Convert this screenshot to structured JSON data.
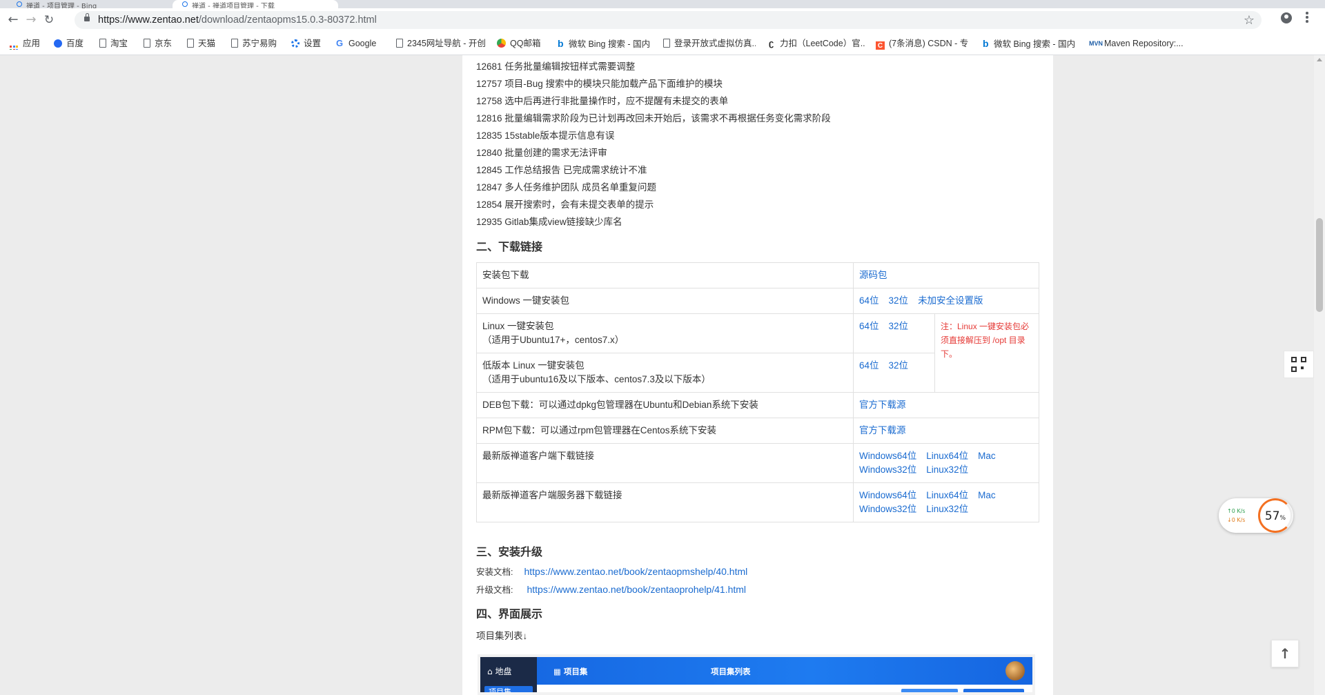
{
  "browser": {
    "tabs": [
      {
        "title": "禅道 - 项目管理 - Bing"
      },
      {
        "title": "禅道 - 禅道项目管理 - 下载"
      }
    ],
    "url_host": "https://www.zentao.net",
    "url_path": "/download/zentaopms15.0.3-80372.html",
    "bookmarks": [
      {
        "label": "应用",
        "icon": "apps-icon"
      },
      {
        "label": "百度",
        "icon": "baidu-paw-icon"
      },
      {
        "label": "淘宝",
        "icon": "page-icon"
      },
      {
        "label": "京东",
        "icon": "page-icon"
      },
      {
        "label": "天猫",
        "icon": "page-icon"
      },
      {
        "label": "苏宁易购",
        "icon": "page-icon"
      },
      {
        "label": "设置",
        "icon": "gear-icon"
      },
      {
        "label": "Google",
        "icon": "google-icon"
      },
      {
        "label": "2345网址导航 - 开创...",
        "icon": "page-icon"
      },
      {
        "label": "QQ邮箱",
        "icon": "qq-mail-icon"
      },
      {
        "label": "微软 Bing 搜索 - 国内...",
        "icon": "bing-icon"
      },
      {
        "label": "登录开放式虚拟仿真...",
        "icon": "page-icon"
      },
      {
        "label": "力扣（LeetCode）官...",
        "icon": "leetcode-icon"
      },
      {
        "label": "(7条消息) CSDN - 专...",
        "icon": "csdn-icon"
      },
      {
        "label": "微软 Bing 搜索 - 国内...",
        "icon": "bing-icon"
      },
      {
        "label": "Maven Repository:...",
        "icon": "maven-icon"
      }
    ]
  },
  "changelog": [
    "12681 任务批量编辑按钮样式需要调整",
    "12757 项目-Bug 搜索中的模块只能加载产品下面维护的模块",
    "12758 选中后再进行非批量操作时，应不提醒有未提交的表单",
    "12816 批量编辑需求阶段为已计划再改回未开始后，该需求不再根据任务变化需求阶段",
    "12835 15stable版本提示信息有误",
    "12840 批量创建的需求无法评审",
    "12845 工作总结报告 已完成需求统计不准",
    "12847 多人任务维护团队 成员名单重复问题",
    "12854 展开搜索时，会有未提交表单的提示",
    "12935 Gitlab集成view链接缺少库名"
  ],
  "download": {
    "heading": "二、下载链接",
    "rows": {
      "header": {
        "label": "安装包下载",
        "link": "源码包"
      },
      "windows": {
        "label": "Windows 一键安装包",
        "links": [
          "64位",
          "32位",
          "未加安全设置版"
        ]
      },
      "linux": {
        "label": "Linux 一键安装包",
        "sub": "（适用于Ubuntu17+，centos7.x）",
        "links": [
          "64位",
          "32位"
        ]
      },
      "linux_old": {
        "label": "低版本 Linux 一键安装包",
        "sub": "（适用于ubuntu16及以下版本、centos7.3及以下版本）",
        "links": [
          "64位",
          "32位"
        ]
      },
      "linux_note": "注：Linux 一键安装包必须直接解压到 /opt 目录下。",
      "deb": {
        "label": "DEB包下载：可以通过dpkg包管理器在Ubuntu和Debian系统下安装",
        "link": "官方下载源"
      },
      "rpm": {
        "label": "RPM包下载：可以通过rpm包管理器在Centos系统下安装",
        "link": "官方下载源"
      },
      "client": {
        "label": "最新版禅道客户端下载链接",
        "links1": [
          "Windows64位",
          "Linux64位",
          "Mac"
        ],
        "links2": [
          "Windows32位",
          "Linux32位"
        ]
      },
      "server": {
        "label": "最新版禅道客户端服务器下载链接",
        "links1": [
          "Windows64位",
          "Linux64位",
          "Mac"
        ],
        "links2": [
          "Windows32位",
          "Linux32位"
        ]
      }
    }
  },
  "install": {
    "heading": "三、安装升级",
    "install_label": "安装文档:",
    "install_url": "https://www.zentao.net/book/zentaopmshelp/40.html",
    "upgrade_label": "升级文档:",
    "upgrade_url": "https://www.zentao.net/book/zentaoprohelp/41.html"
  },
  "interface": {
    "heading": "四、界面展示",
    "list_label": "项目集列表↓",
    "preview": {
      "home": "地盘",
      "program": "项目集",
      "list": "项目集列表",
      "side_item": "项目集"
    }
  },
  "widgets": {
    "upload_rate": "↑0  K/s",
    "download_rate": "↓0  K/s",
    "percent": "57",
    "percent_unit": "%"
  }
}
